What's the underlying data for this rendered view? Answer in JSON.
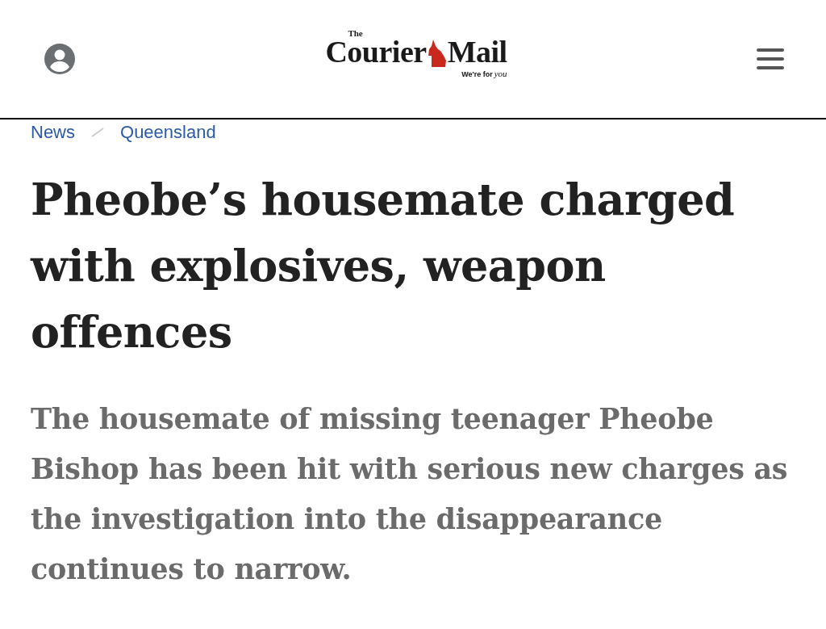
{
  "header": {
    "logo": {
      "small": "The",
      "main_left": "Courier",
      "main_right": "Mail",
      "tagline": "We're for",
      "tagline_script": "you"
    }
  },
  "breadcrumb": [
    "News",
    "Queensland"
  ],
  "headline": "Pheobe’s housemate charged with explosives, weapon offences",
  "standfirst": "The housemate of missing teenager Pheobe Bishop has been hit with serious new charges as the investigation into the disappearance continues to narrow."
}
